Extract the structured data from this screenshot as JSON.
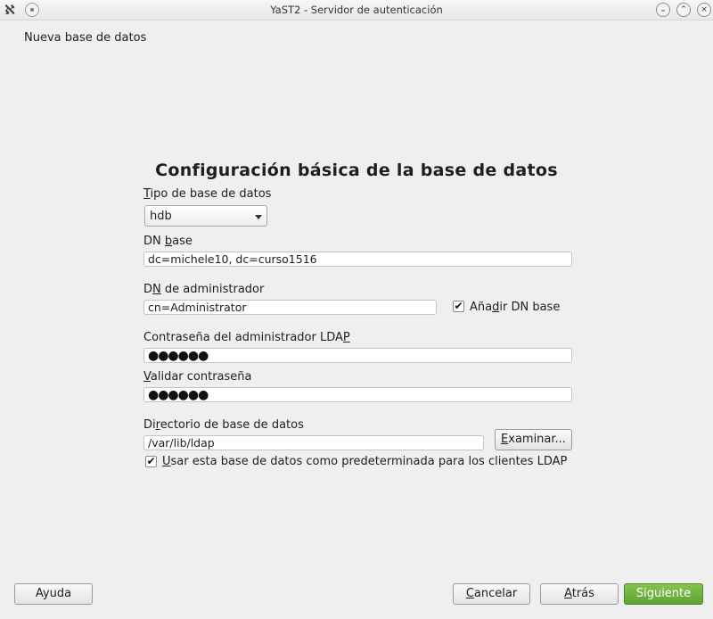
{
  "window": {
    "title": "YaST2 - Servidor de autenticación",
    "minimize": "⌄",
    "maximize": "⌃",
    "close": "×"
  },
  "page": {
    "subtitle": "Nueva base de datos",
    "heading": "Configuración básica de la base de datos"
  },
  "form": {
    "db_type": {
      "label_pre": "",
      "label_mn": "T",
      "label_post": "ipo de base de datos",
      "value": "hdb"
    },
    "base_dn": {
      "label_pre": "DN ",
      "label_mn": "b",
      "label_post": "ase",
      "value": "dc=michele10, dc=curso1516"
    },
    "admin_dn": {
      "label_pre": "D",
      "label_mn": "N",
      "label_post": " de administrador",
      "value": "cn=Administrator"
    },
    "append_base_dn": {
      "label_pre": "Aña",
      "label_mn": "d",
      "label_post": "ir DN base",
      "checked": "✔"
    },
    "ldap_password": {
      "label_pre": "Contraseña del administrador LDA",
      "label_mn": "P",
      "label_post": "",
      "value": "●●●●●●"
    },
    "validate_password": {
      "label_pre": "",
      "label_mn": "V",
      "label_post": "alidar contraseña",
      "value": "●●●●●●"
    },
    "db_directory": {
      "label_pre": "Di",
      "label_mn": "r",
      "label_post": "ectorio de base de datos",
      "value": "/var/lib/ldap",
      "browse_pre": "",
      "browse_mn": "E",
      "browse_post": "xaminar..."
    },
    "use_default": {
      "label_pre": "",
      "label_mn": "U",
      "label_post": "sar esta base de datos como predeterminada para los clientes LDAP",
      "checked": "✔"
    }
  },
  "footer": {
    "help": "Ayuda",
    "cancel_mn": "C",
    "cancel_post": "ancelar",
    "back_mn": "A",
    "back_post": "trás",
    "next": "Siguiente"
  },
  "colors": {
    "primary_button": "#6aab3c",
    "background": "#efefef"
  }
}
